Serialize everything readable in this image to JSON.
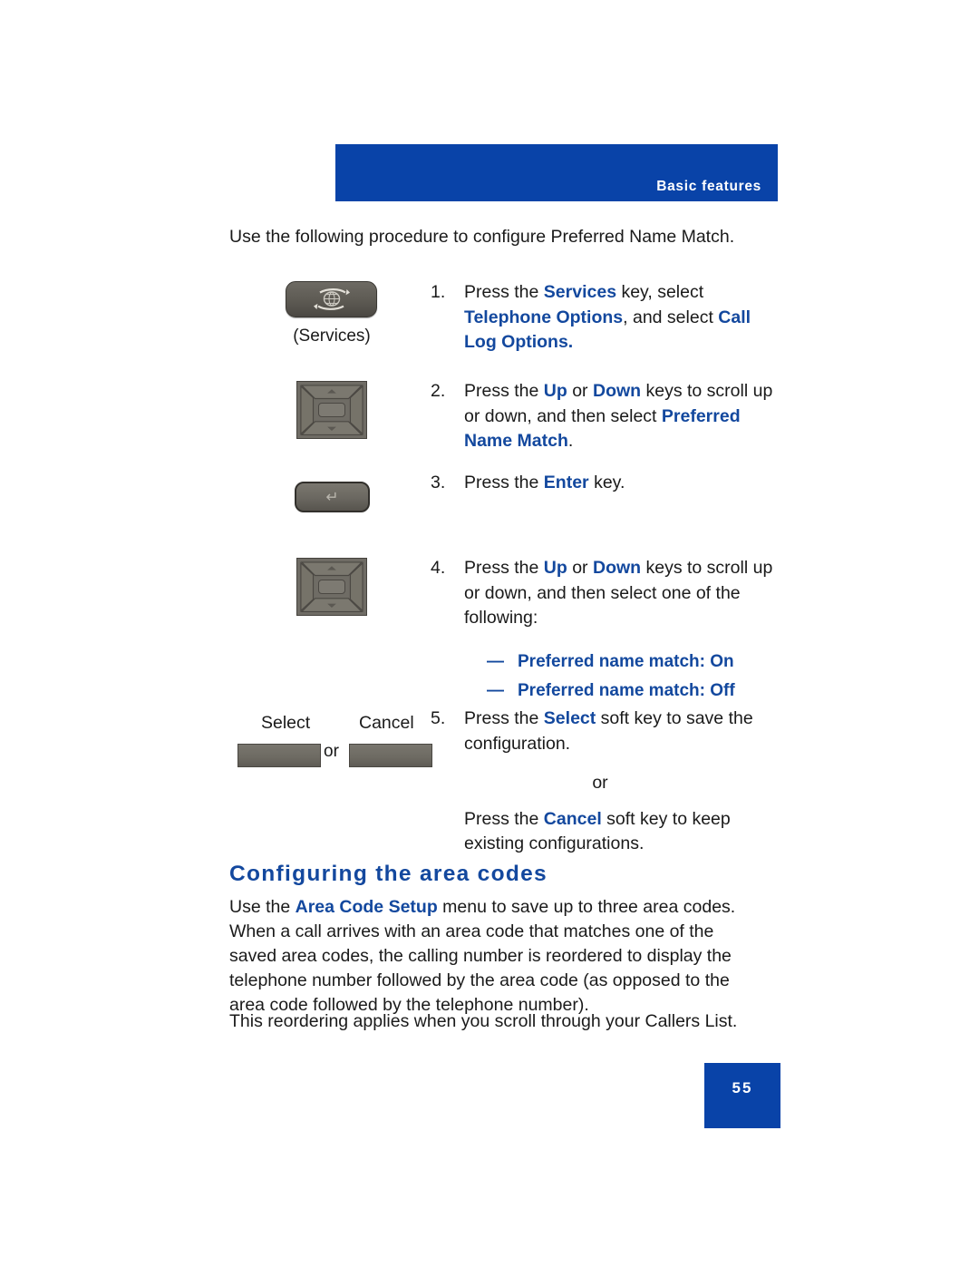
{
  "header": {
    "title": "Basic features",
    "band_color": "#0943a8"
  },
  "theme": {
    "accent_blue": "#13489e",
    "banner_blue": "#0943a8",
    "body_text": "#1a1a1a"
  },
  "intro": {
    "text": "Use the following procedure to configure Preferred Name Match."
  },
  "steps": [
    {
      "number": "1.",
      "line1_pre": "Press the ",
      "line1_bold": "Services",
      "line1_post": " key, select",
      "line2_bold": "Telephone Options",
      "line2_mid": ", and select ",
      "line2_bold2": "Call",
      "line3_bold": "Log Options."
    },
    {
      "number": "2.",
      "line1_pre": "Press the ",
      "line1_bold": "Up",
      "line1_mid": " or ",
      "line1_bold2": "Down",
      "line1_post": " keys to scroll up",
      "line2_pre": "or down, and then select ",
      "line2_bold": "Preferred",
      "line3_bold": "Name Match",
      "line3_post": "."
    },
    {
      "number": "3.",
      "line1_pre": "Press the ",
      "line1_bold": "Enter",
      "line1_post": " key."
    },
    {
      "number": "4.",
      "line1_pre": "Press the ",
      "line1_bold": "Up",
      "line1_mid": " or ",
      "line1_bold2": "Down",
      "line1_post": " keys to scroll up",
      "line2": "or down, and then select one of the",
      "line3": "following:",
      "options": [
        {
          "dash": "—",
          "label": "Preferred name match: On"
        },
        {
          "dash": "—",
          "label": "Preferred name match: Off"
        }
      ]
    },
    {
      "number": "5.",
      "line1_pre": "Press the ",
      "line1_bold": "Select",
      "line1_post": " soft key to save the",
      "line2": "configuration.",
      "or_label": "or",
      "line3_pre": "Press the ",
      "line3_bold": "Cancel",
      "line3_post": " soft key to keep",
      "line4": "existing configurations."
    }
  ],
  "keys": {
    "services": {
      "caption": "(Services)",
      "icon": "globe-arrows-icon"
    },
    "navigation": {
      "icon": "four-way-navigation-icon"
    },
    "enter": {
      "icon": "enter-return-icon",
      "glyph": "↵"
    },
    "softkeys": {
      "select_label": "Select",
      "cancel_label": "Cancel",
      "or_label": "or"
    }
  },
  "section": {
    "heading": "Configuring the area codes",
    "paragraph1_pre": "Use the ",
    "paragraph1_bold": "Area Code Setup",
    "paragraph1_post": " menu to save up to three area codes. When a call arrives with an area code that matches one of the saved area codes, the calling number is reordered to display the telephone number followed by the area code (as opposed to the area code followed by the telephone number).",
    "paragraph2": "This reordering applies when you scroll through your Callers List."
  },
  "footer": {
    "page_number": "55"
  }
}
